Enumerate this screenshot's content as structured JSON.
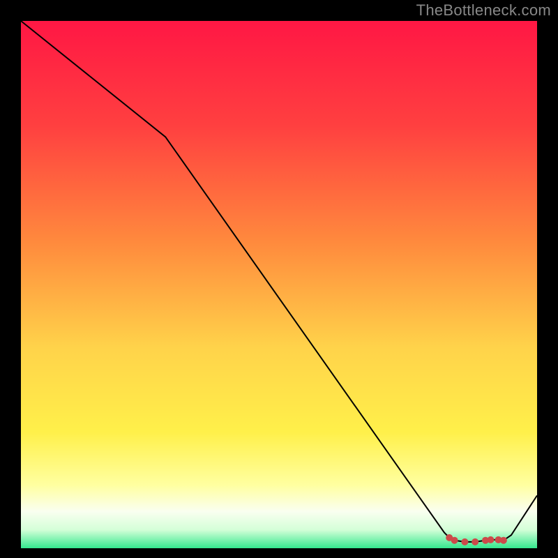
{
  "attribution": "TheBottleneck.com",
  "chart_data": {
    "type": "line",
    "title": "",
    "xlabel": "",
    "ylabel": "",
    "xlim": [
      0,
      100
    ],
    "ylim": [
      0,
      100
    ],
    "x": [
      0,
      28,
      82,
      83,
      84,
      86,
      88,
      90,
      91,
      92.5,
      93.5,
      95,
      100
    ],
    "values": [
      100,
      78,
      3,
      2,
      1.5,
      1.2,
      1.2,
      1.5,
      1.6,
      1.6,
      1.5,
      2.5,
      10
    ],
    "markers_x": [
      83,
      84,
      86,
      88,
      90,
      91,
      92.5,
      93.5
    ],
    "markers_y": [
      2,
      1.5,
      1.2,
      1.2,
      1.5,
      1.6,
      1.6,
      1.5
    ],
    "gradient_stops": [
      {
        "offset": 0.0,
        "color": "#ff1744"
      },
      {
        "offset": 0.2,
        "color": "#ff4040"
      },
      {
        "offset": 0.42,
        "color": "#ff8a3d"
      },
      {
        "offset": 0.62,
        "color": "#ffd34a"
      },
      {
        "offset": 0.78,
        "color": "#fff04a"
      },
      {
        "offset": 0.88,
        "color": "#ffffa0"
      },
      {
        "offset": 0.93,
        "color": "#fafff0"
      },
      {
        "offset": 0.965,
        "color": "#d4ffd8"
      },
      {
        "offset": 1.0,
        "color": "#34e88e"
      }
    ],
    "marker_color": "#cc4a4a",
    "line_color": "#000000"
  }
}
